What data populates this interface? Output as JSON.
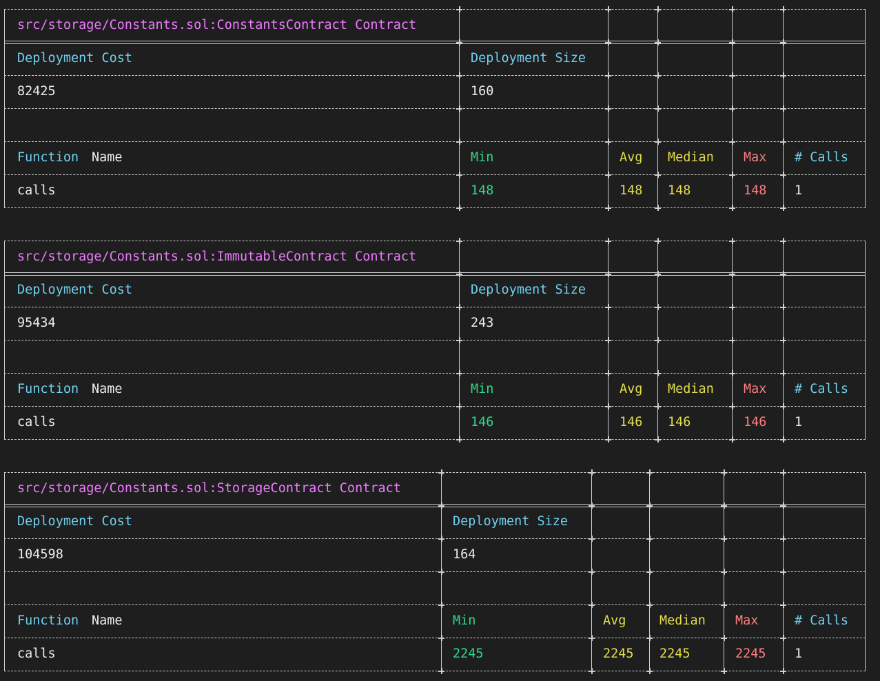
{
  "contracts": [
    {
      "title": "src/storage/Constants.sol:ConstantsContract Contract",
      "headers": {
        "deployment_cost": "Deployment Cost",
        "deployment_size": "Deployment Size",
        "function_word": "Function",
        "name_word": "Name",
        "min": "Min",
        "avg": "Avg",
        "median": "Median",
        "max": "Max",
        "calls": "# Calls"
      },
      "deployment": {
        "cost": "82425",
        "size": "160"
      },
      "functions": [
        {
          "name": "calls",
          "min": "148",
          "avg": "148",
          "median": "148",
          "max": "148",
          "calls": "1"
        }
      ]
    },
    {
      "title": "src/storage/Constants.sol:ImmutableContract Contract",
      "headers": {
        "deployment_cost": "Deployment Cost",
        "deployment_size": "Deployment Size",
        "function_word": "Function",
        "name_word": "Name",
        "min": "Min",
        "avg": "Avg",
        "median": "Median",
        "max": "Max",
        "calls": "# Calls"
      },
      "deployment": {
        "cost": "95434",
        "size": "243"
      },
      "functions": [
        {
          "name": "calls",
          "min": "146",
          "avg": "146",
          "median": "146",
          "max": "146",
          "calls": "1"
        }
      ]
    },
    {
      "title": "src/storage/Constants.sol:StorageContract Contract",
      "headers": {
        "deployment_cost": "Deployment Cost",
        "deployment_size": "Deployment Size",
        "function_word": "Function",
        "name_word": "Name",
        "min": "Min",
        "avg": "Avg",
        "median": "Median",
        "max": "Max",
        "calls": "# Calls"
      },
      "deployment": {
        "cost": "104598",
        "size": "164"
      },
      "functions": [
        {
          "name": "calls",
          "min": "2245",
          "avg": "2245",
          "median": "2245",
          "max": "2245",
          "calls": "1"
        }
      ]
    }
  ],
  "colors": {
    "background": "#1e1e1e",
    "title": "#ee7bff",
    "header": "#6fd0ef",
    "min": "#2fd88a",
    "avg_median": "#e4dc4a",
    "max": "#ff7e7e",
    "text": "#ececec"
  }
}
